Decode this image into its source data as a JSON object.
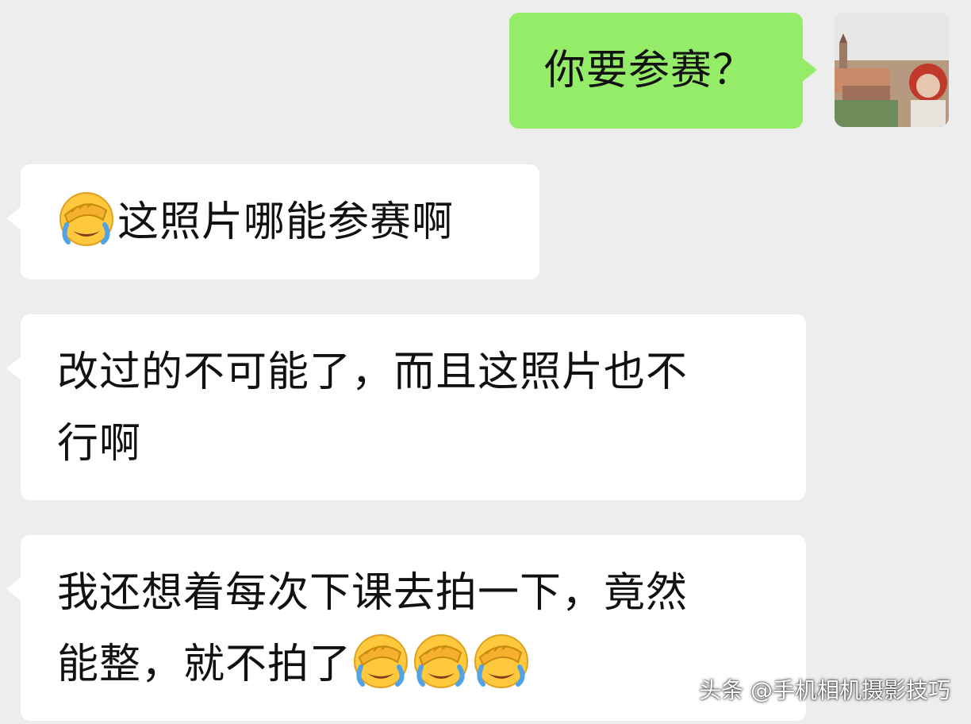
{
  "chat": {
    "messages": [
      {
        "direction": "outgoing",
        "text": "你要参赛？"
      },
      {
        "direction": "incoming",
        "emoji": "facepalm-crying",
        "text": "这照片哪能参赛啊"
      },
      {
        "direction": "incoming",
        "line1": "改过的不可能了，而且这照片也不",
        "line2": "行啊"
      },
      {
        "direction": "incoming",
        "line1": "我还想着每次下课去拍一下，竟然",
        "line2": "能整，就不拍了",
        "trailing_emoji": [
          "facepalm-crying",
          "facepalm-crying",
          "facepalm-crying"
        ]
      }
    ]
  },
  "avatar": {
    "icon": "scenic-town-photo-avatar"
  },
  "watermark": {
    "text": "头条 @手机相机摄影技巧"
  },
  "colors": {
    "background": "#EDEDED",
    "outgoing_bubble": "#95EC69",
    "incoming_bubble": "#FFFFFF",
    "text": "#111111"
  }
}
